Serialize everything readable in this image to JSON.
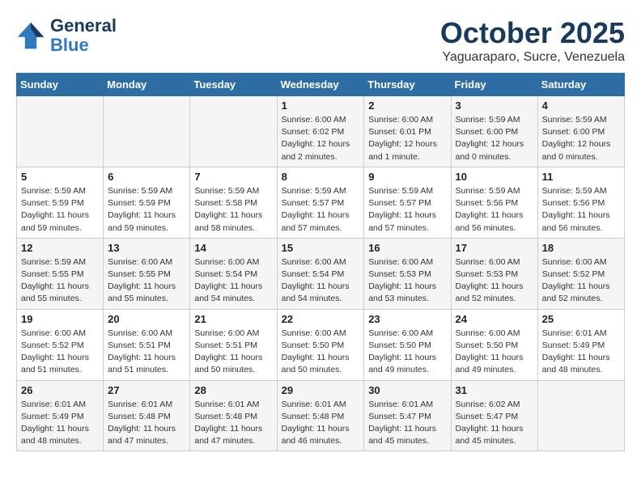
{
  "header": {
    "logo_line1": "General",
    "logo_line2": "Blue",
    "month_title": "October 2025",
    "subtitle": "Yaguaraparo, Sucre, Venezuela"
  },
  "days_of_week": [
    "Sunday",
    "Monday",
    "Tuesday",
    "Wednesday",
    "Thursday",
    "Friday",
    "Saturday"
  ],
  "weeks": [
    [
      {
        "day": "",
        "info": ""
      },
      {
        "day": "",
        "info": ""
      },
      {
        "day": "",
        "info": ""
      },
      {
        "day": "1",
        "info": "Sunrise: 6:00 AM\nSunset: 6:02 PM\nDaylight: 12 hours\nand 2 minutes."
      },
      {
        "day": "2",
        "info": "Sunrise: 6:00 AM\nSunset: 6:01 PM\nDaylight: 12 hours\nand 1 minute."
      },
      {
        "day": "3",
        "info": "Sunrise: 5:59 AM\nSunset: 6:00 PM\nDaylight: 12 hours\nand 0 minutes."
      },
      {
        "day": "4",
        "info": "Sunrise: 5:59 AM\nSunset: 6:00 PM\nDaylight: 12 hours\nand 0 minutes."
      }
    ],
    [
      {
        "day": "5",
        "info": "Sunrise: 5:59 AM\nSunset: 5:59 PM\nDaylight: 11 hours\nand 59 minutes."
      },
      {
        "day": "6",
        "info": "Sunrise: 5:59 AM\nSunset: 5:59 PM\nDaylight: 11 hours\nand 59 minutes."
      },
      {
        "day": "7",
        "info": "Sunrise: 5:59 AM\nSunset: 5:58 PM\nDaylight: 11 hours\nand 58 minutes."
      },
      {
        "day": "8",
        "info": "Sunrise: 5:59 AM\nSunset: 5:57 PM\nDaylight: 11 hours\nand 57 minutes."
      },
      {
        "day": "9",
        "info": "Sunrise: 5:59 AM\nSunset: 5:57 PM\nDaylight: 11 hours\nand 57 minutes."
      },
      {
        "day": "10",
        "info": "Sunrise: 5:59 AM\nSunset: 5:56 PM\nDaylight: 11 hours\nand 56 minutes."
      },
      {
        "day": "11",
        "info": "Sunrise: 5:59 AM\nSunset: 5:56 PM\nDaylight: 11 hours\nand 56 minutes."
      }
    ],
    [
      {
        "day": "12",
        "info": "Sunrise: 5:59 AM\nSunset: 5:55 PM\nDaylight: 11 hours\nand 55 minutes."
      },
      {
        "day": "13",
        "info": "Sunrise: 6:00 AM\nSunset: 5:55 PM\nDaylight: 11 hours\nand 55 minutes."
      },
      {
        "day": "14",
        "info": "Sunrise: 6:00 AM\nSunset: 5:54 PM\nDaylight: 11 hours\nand 54 minutes."
      },
      {
        "day": "15",
        "info": "Sunrise: 6:00 AM\nSunset: 5:54 PM\nDaylight: 11 hours\nand 54 minutes."
      },
      {
        "day": "16",
        "info": "Sunrise: 6:00 AM\nSunset: 5:53 PM\nDaylight: 11 hours\nand 53 minutes."
      },
      {
        "day": "17",
        "info": "Sunrise: 6:00 AM\nSunset: 5:53 PM\nDaylight: 11 hours\nand 52 minutes."
      },
      {
        "day": "18",
        "info": "Sunrise: 6:00 AM\nSunset: 5:52 PM\nDaylight: 11 hours\nand 52 minutes."
      }
    ],
    [
      {
        "day": "19",
        "info": "Sunrise: 6:00 AM\nSunset: 5:52 PM\nDaylight: 11 hours\nand 51 minutes."
      },
      {
        "day": "20",
        "info": "Sunrise: 6:00 AM\nSunset: 5:51 PM\nDaylight: 11 hours\nand 51 minutes."
      },
      {
        "day": "21",
        "info": "Sunrise: 6:00 AM\nSunset: 5:51 PM\nDaylight: 11 hours\nand 50 minutes."
      },
      {
        "day": "22",
        "info": "Sunrise: 6:00 AM\nSunset: 5:50 PM\nDaylight: 11 hours\nand 50 minutes."
      },
      {
        "day": "23",
        "info": "Sunrise: 6:00 AM\nSunset: 5:50 PM\nDaylight: 11 hours\nand 49 minutes."
      },
      {
        "day": "24",
        "info": "Sunrise: 6:00 AM\nSunset: 5:50 PM\nDaylight: 11 hours\nand 49 minutes."
      },
      {
        "day": "25",
        "info": "Sunrise: 6:01 AM\nSunset: 5:49 PM\nDaylight: 11 hours\nand 48 minutes."
      }
    ],
    [
      {
        "day": "26",
        "info": "Sunrise: 6:01 AM\nSunset: 5:49 PM\nDaylight: 11 hours\nand 48 minutes."
      },
      {
        "day": "27",
        "info": "Sunrise: 6:01 AM\nSunset: 5:48 PM\nDaylight: 11 hours\nand 47 minutes."
      },
      {
        "day": "28",
        "info": "Sunrise: 6:01 AM\nSunset: 5:48 PM\nDaylight: 11 hours\nand 47 minutes."
      },
      {
        "day": "29",
        "info": "Sunrise: 6:01 AM\nSunset: 5:48 PM\nDaylight: 11 hours\nand 46 minutes."
      },
      {
        "day": "30",
        "info": "Sunrise: 6:01 AM\nSunset: 5:47 PM\nDaylight: 11 hours\nand 45 minutes."
      },
      {
        "day": "31",
        "info": "Sunrise: 6:02 AM\nSunset: 5:47 PM\nDaylight: 11 hours\nand 45 minutes."
      },
      {
        "day": "",
        "info": ""
      }
    ]
  ]
}
